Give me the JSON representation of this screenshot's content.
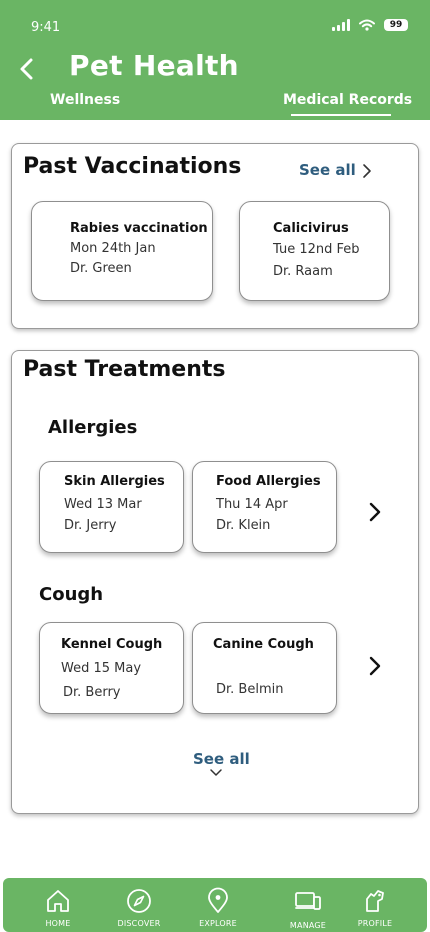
{
  "status": {
    "time": "9:41",
    "battery": "99"
  },
  "header": {
    "title": "Pet Health",
    "tabs": [
      {
        "label": "Wellness"
      },
      {
        "label": "Medical Records"
      }
    ]
  },
  "vaccinations": {
    "title": "Past Vaccinations",
    "see_all": "See all",
    "cards": [
      {
        "title": "Rabies vaccination",
        "date": "Mon 24th Jan",
        "doctor": "Dr. Green"
      },
      {
        "title": "Calicivirus",
        "date": "Tue 12nd Feb",
        "doctor": "Dr. Raam"
      }
    ]
  },
  "treatments": {
    "title": "Past Treatments",
    "see_all": "See all",
    "groups": [
      {
        "name": "Allergies",
        "cards": [
          {
            "title": "Skin Allergies",
            "date": "Wed 13 Mar",
            "doctor": "Dr. Jerry"
          },
          {
            "title": "Food Allergies",
            "date": "Thu 14 Apr",
            "doctor": "Dr. Klein"
          }
        ]
      },
      {
        "name": "Cough",
        "cards": [
          {
            "title": "Kennel Cough",
            "date": "Wed 15 May",
            "doctor": "Dr. Berry"
          },
          {
            "title": "Canine Cough",
            "date": "",
            "doctor": "Dr. Belmin"
          }
        ]
      }
    ]
  },
  "bottom_nav": [
    {
      "label": "HOME",
      "icon": "home-icon"
    },
    {
      "label": "DISCOVER",
      "icon": "compass-icon"
    },
    {
      "label": "EXPLORE",
      "icon": "map-pin-icon"
    },
    {
      "label": "MANAGE",
      "icon": "devices-icon"
    },
    {
      "label": "PROFILE",
      "icon": "pet-profile-icon"
    }
  ],
  "colors": {
    "brand_green": "#6ab564",
    "link_blue": "#2f5d7e"
  }
}
